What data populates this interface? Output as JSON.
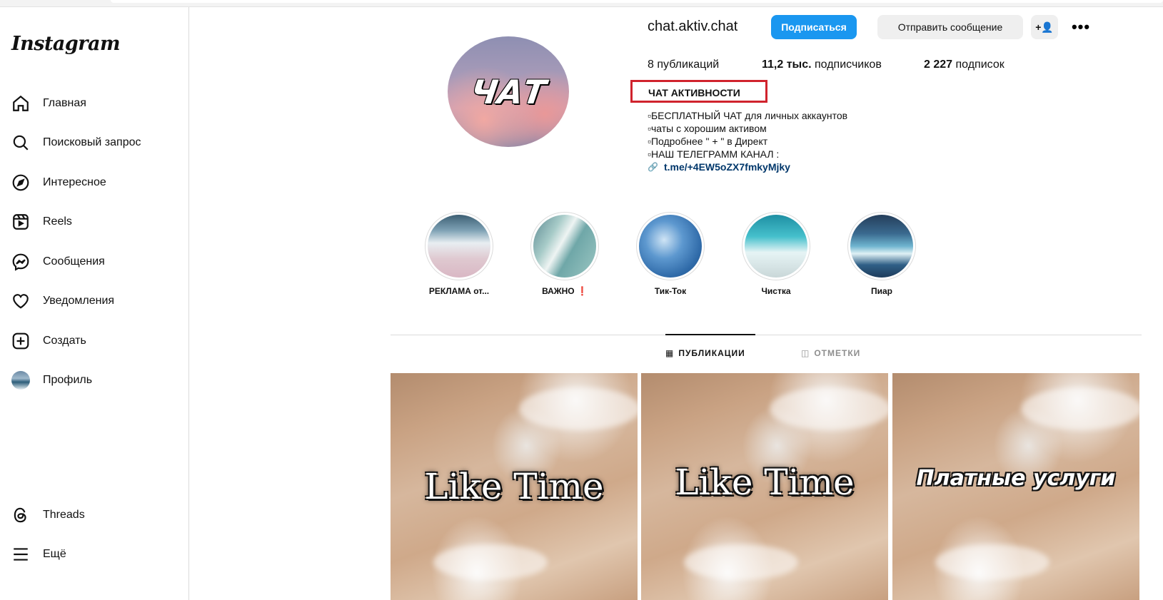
{
  "app": {
    "logo": "Instagram"
  },
  "sidebar": {
    "items": [
      {
        "label": "Главная",
        "icon": "home-icon"
      },
      {
        "label": "Поисковый запрос",
        "icon": "search-icon"
      },
      {
        "label": "Интересное",
        "icon": "compass-icon"
      },
      {
        "label": "Reels",
        "icon": "reels-icon"
      },
      {
        "label": "Сообщения",
        "icon": "messenger-icon"
      },
      {
        "label": "Уведомления",
        "icon": "heart-icon"
      },
      {
        "label": "Создать",
        "icon": "plus-icon"
      },
      {
        "label": "Профиль",
        "icon": "avatar-icon"
      }
    ],
    "bottom": [
      {
        "label": "Threads",
        "icon": "threads-icon"
      },
      {
        "label": "Ещё",
        "icon": "menu-icon"
      }
    ]
  },
  "profile": {
    "username": "chat.aktiv.chat",
    "avatar_text": "ЧАТ",
    "follow_label": "Подписаться",
    "message_label": "Отправить сообщение",
    "add_icon_text": "+👤",
    "more_icon_text": "•••",
    "stats": {
      "posts_count": "8",
      "posts_label": "публикаций",
      "followers_count": "11,2 тыс.",
      "followers_label": "подписчиков",
      "following_count": "2 227",
      "following_label": "подписок"
    },
    "full_name": "ЧАТ АКТИВНОСТИ",
    "bio": [
      "▫БЕСПЛАТНЫЙ ЧАТ для личных аккаунтов",
      "▫чаты с хорошим активом",
      "▫Подробнее \" + \" в Директ",
      "▫НАШ ТЕЛЕГРАММ КАНАЛ :"
    ],
    "link": "t.me/+4EW5oZX7fmkyMjky",
    "highlight_box_color": "#d0232d"
  },
  "highlights": [
    {
      "label": "РЕКЛАМА от..."
    },
    {
      "label": "ВАЖНО ❗"
    },
    {
      "label": "Тик-Ток"
    },
    {
      "label": "Чистка"
    },
    {
      "label": "Пиар"
    }
  ],
  "tabs": [
    {
      "label": "ПУБЛИКАЦИИ",
      "icon": "grid-icon",
      "active": true
    },
    {
      "label": "ОТМЕТКИ",
      "icon": "tagged-icon",
      "active": false
    }
  ],
  "posts": [
    {
      "text": "Like Time"
    },
    {
      "text": "Like Time"
    },
    {
      "text": "Платные услуги"
    }
  ],
  "colors": {
    "accent": "#1a97f0",
    "link": "#00376b"
  }
}
